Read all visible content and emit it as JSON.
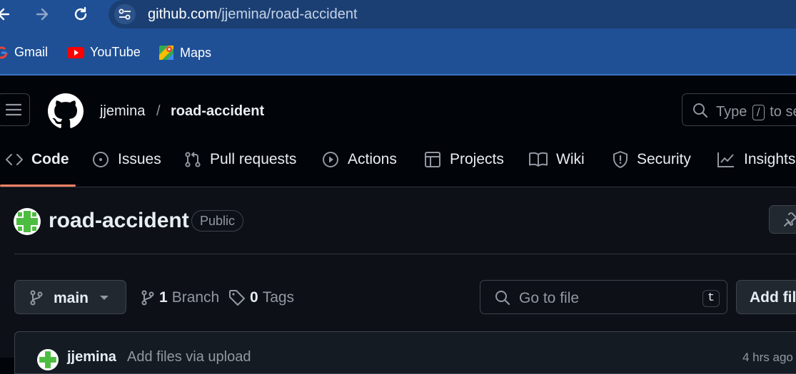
{
  "browser": {
    "url_host": "github.com",
    "url_path": "/jjemina/road-accident",
    "bookmarks": [
      {
        "label": "Gmail",
        "icon": "google-icon"
      },
      {
        "label": "YouTube",
        "icon": "youtube-icon"
      },
      {
        "label": "Maps",
        "icon": "maps-icon"
      }
    ]
  },
  "header": {
    "owner": "jjemina",
    "separator": "/",
    "repo": "road-accident",
    "search": {
      "prefix": "Type",
      "key": "/",
      "suffix": "to se"
    }
  },
  "tabs": [
    {
      "label": "Code",
      "icon": "code-icon",
      "selected": true
    },
    {
      "label": "Issues",
      "icon": "issue-icon"
    },
    {
      "label": "Pull requests",
      "icon": "pull-request-icon"
    },
    {
      "label": "Actions",
      "icon": "play-icon"
    },
    {
      "label": "Projects",
      "icon": "table-icon"
    },
    {
      "label": "Wiki",
      "icon": "book-icon"
    },
    {
      "label": "Security",
      "icon": "shield-icon"
    },
    {
      "label": "Insights",
      "icon": "graph-icon"
    }
  ],
  "repo": {
    "title": "road-accident",
    "visibility": "Public",
    "branch": "main",
    "branches_count": "1",
    "branches_label": "Branch",
    "tags_count": "0",
    "tags_label": "Tags",
    "go_to_file_placeholder": "Go to file",
    "go_to_file_key": "t",
    "add_file_label": "Add file"
  },
  "commit": {
    "author": "jjemina",
    "message": "Add files via upload",
    "time": "4 hrs ago"
  },
  "colors": {
    "accent_underline": "#f78166",
    "avatar_green": "#4dbd41",
    "chrome_blue": "#1f5096"
  }
}
